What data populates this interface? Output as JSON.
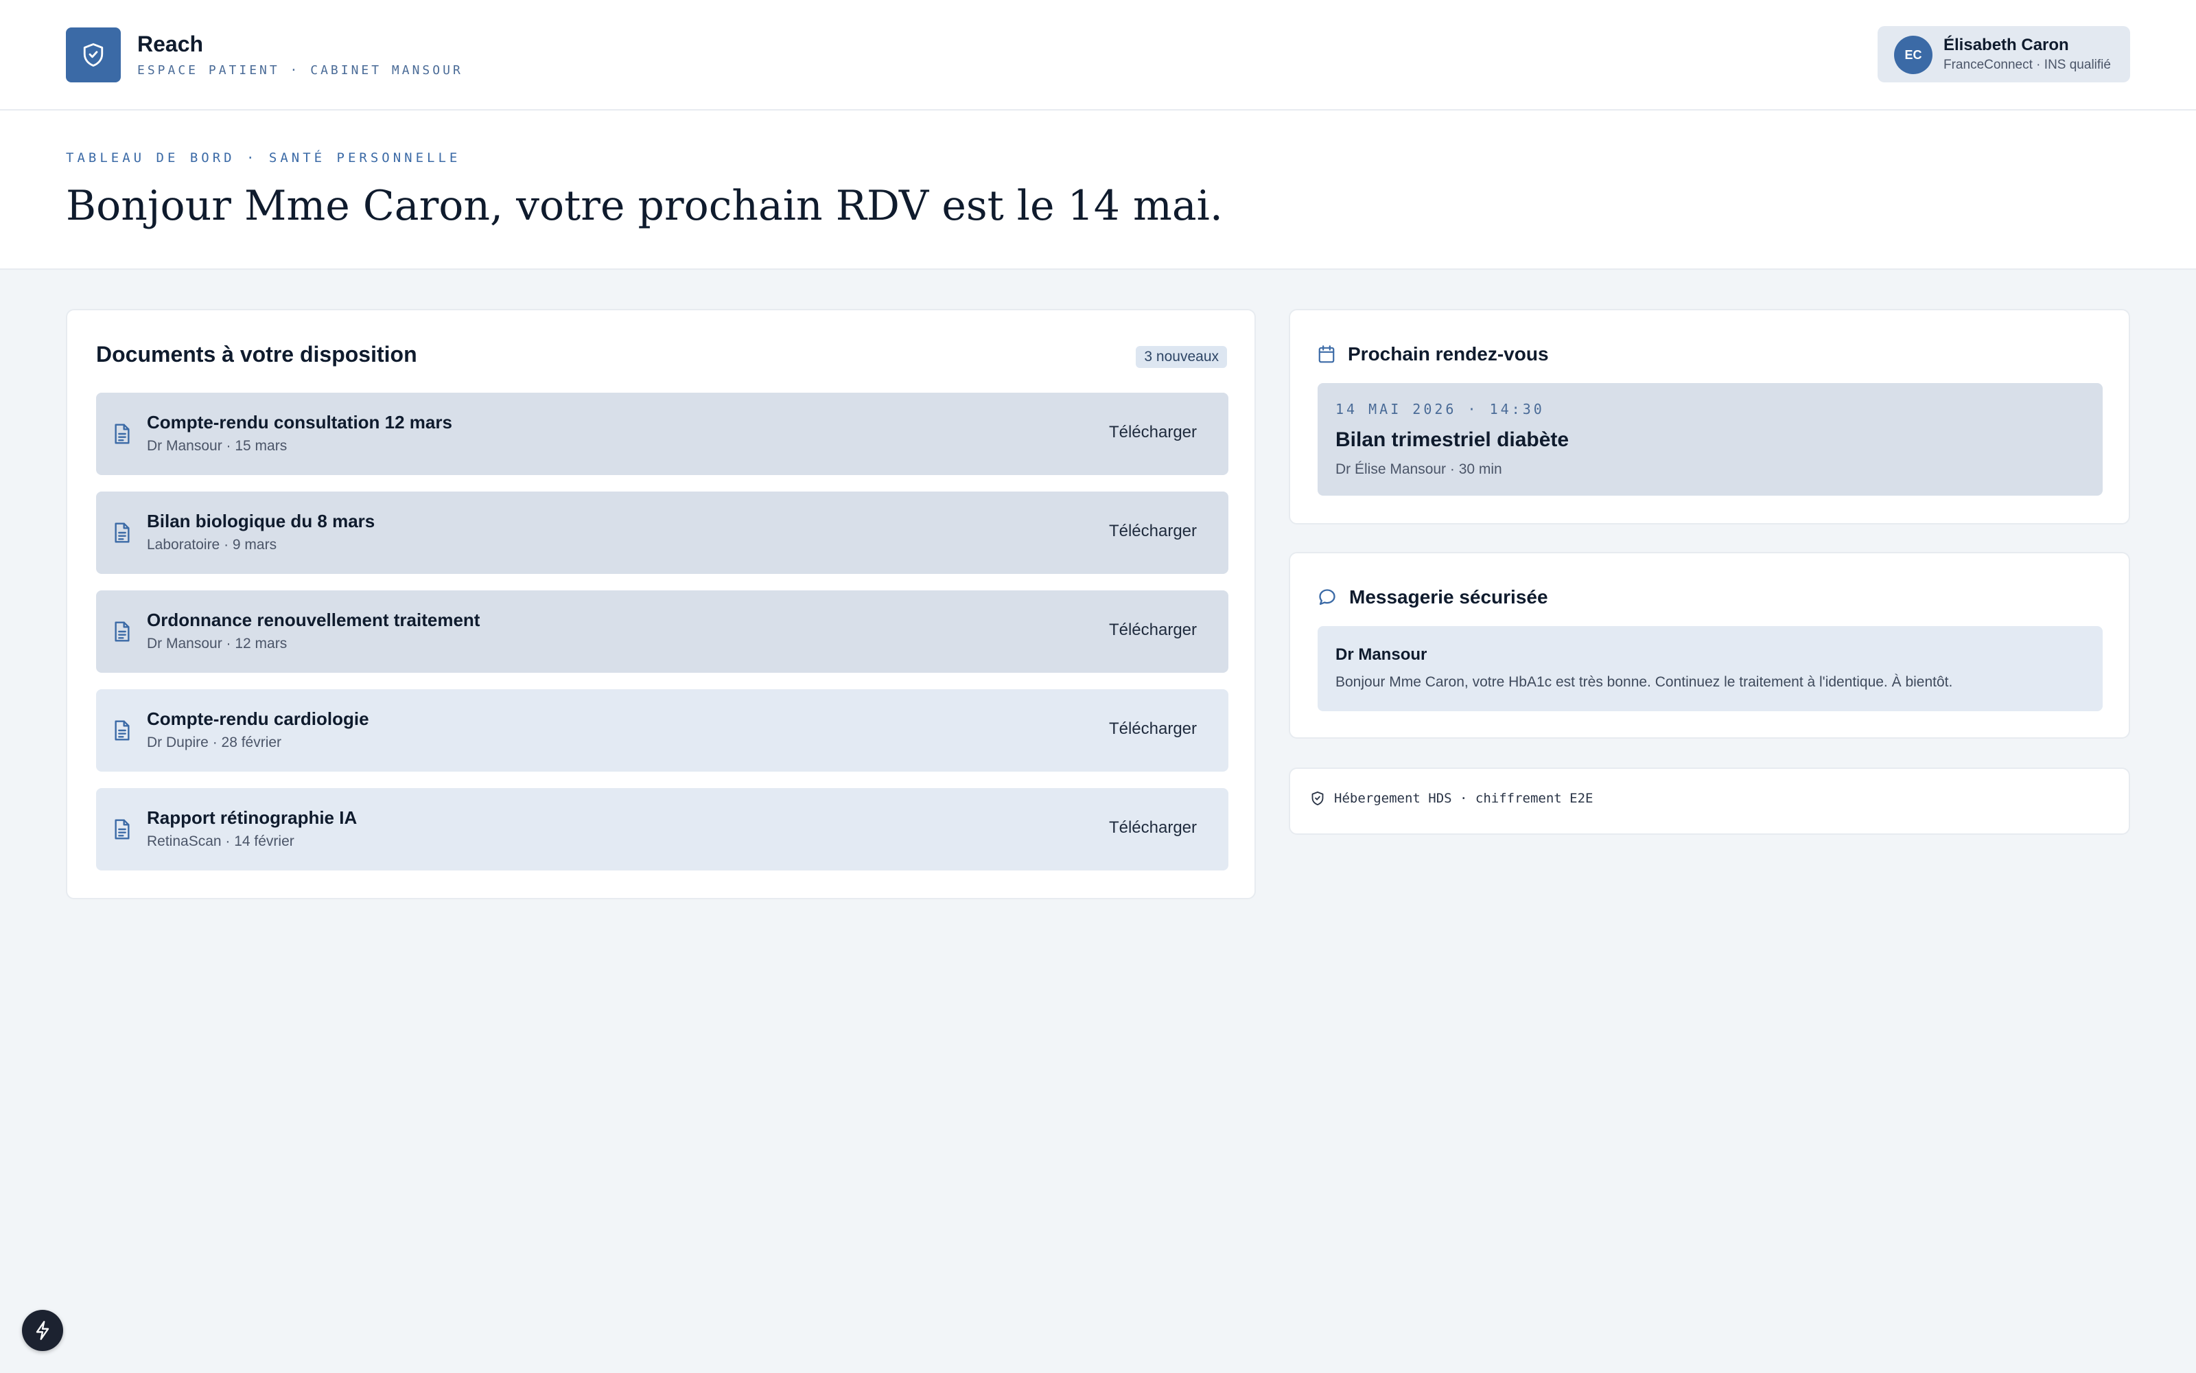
{
  "colors": {
    "brand": "#3b6aa6",
    "background": "#f2f5f8",
    "row_dark": "#d8dfe9",
    "row_light": "#e3eaf3"
  },
  "header": {
    "brand_name": "Reach",
    "brand_sub": "ESPACE PATIENT · CABINET MANSOUR",
    "logo_icon": "shield-check-icon",
    "user": {
      "initials": "EC",
      "name": "Élisabeth Caron",
      "sub": "FranceConnect · INS qualifié"
    }
  },
  "hero": {
    "eyebrow": "TABLEAU DE BORD · SANTÉ PERSONNELLE",
    "title": "Bonjour Mme Caron, votre prochain RDV est le 14 mai."
  },
  "documents": {
    "title": "Documents à votre disposition",
    "badge": "3 nouveaux",
    "download_label": "Télécharger",
    "icon": "document-icon",
    "items": [
      {
        "name": "Compte-rendu consultation 12 mars",
        "meta": "Dr Mansour · 15 mars"
      },
      {
        "name": "Bilan biologique du 8 mars",
        "meta": "Laboratoire · 9 mars"
      },
      {
        "name": "Ordonnance renouvellement traitement",
        "meta": "Dr Mansour · 12 mars"
      },
      {
        "name": "Compte-rendu cardiologie",
        "meta": "Dr Dupire · 28 février"
      },
      {
        "name": "Rapport rétinographie IA",
        "meta": "RetinaScan · 14 février"
      }
    ]
  },
  "appointment": {
    "title": "Prochain rendez-vous",
    "icon": "calendar-icon",
    "when": "14 MAI 2026 · 14:30",
    "name": "Bilan trimestriel diabète",
    "meta": "Dr Élise Mansour · 30 min"
  },
  "messages": {
    "title": "Messagerie sécurisée",
    "icon": "chat-bubble-icon",
    "from": "Dr Mansour",
    "text": "Bonjour Mme Caron, votre HbA1c est très bonne. Continuez le traitement à l'identique. À bientôt."
  },
  "security": {
    "icon": "shield-check-icon",
    "text": "Hébergement HDS · chiffrement E2E"
  },
  "fab": {
    "icon": "lightning-icon"
  }
}
